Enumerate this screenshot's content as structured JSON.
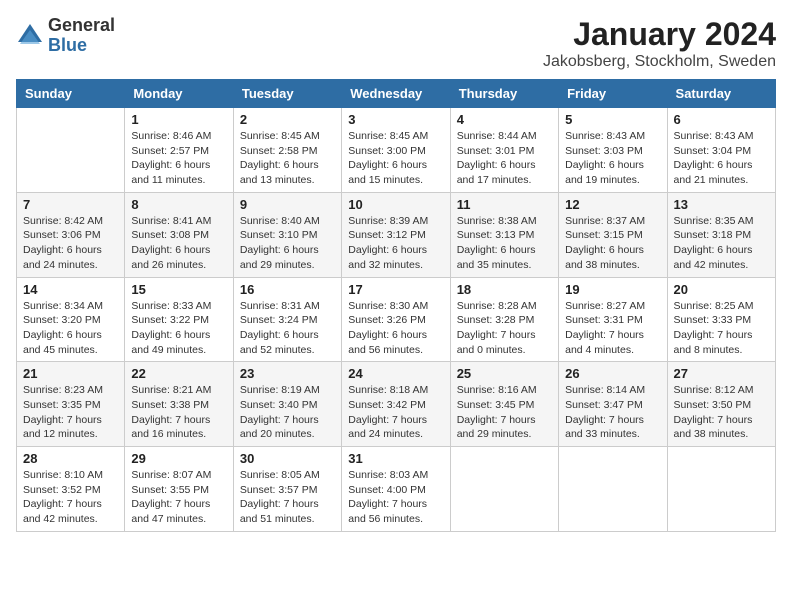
{
  "logo": {
    "line1": "General",
    "line2": "Blue"
  },
  "title": "January 2024",
  "subtitle": "Jakobsberg, Stockholm, Sweden",
  "days_of_week": [
    "Sunday",
    "Monday",
    "Tuesday",
    "Wednesday",
    "Thursday",
    "Friday",
    "Saturday"
  ],
  "weeks": [
    [
      {
        "num": "",
        "sunrise": "",
        "sunset": "",
        "daylight": ""
      },
      {
        "num": "1",
        "sunrise": "Sunrise: 8:46 AM",
        "sunset": "Sunset: 2:57 PM",
        "daylight": "Daylight: 6 hours and 11 minutes."
      },
      {
        "num": "2",
        "sunrise": "Sunrise: 8:45 AM",
        "sunset": "Sunset: 2:58 PM",
        "daylight": "Daylight: 6 hours and 13 minutes."
      },
      {
        "num": "3",
        "sunrise": "Sunrise: 8:45 AM",
        "sunset": "Sunset: 3:00 PM",
        "daylight": "Daylight: 6 hours and 15 minutes."
      },
      {
        "num": "4",
        "sunrise": "Sunrise: 8:44 AM",
        "sunset": "Sunset: 3:01 PM",
        "daylight": "Daylight: 6 hours and 17 minutes."
      },
      {
        "num": "5",
        "sunrise": "Sunrise: 8:43 AM",
        "sunset": "Sunset: 3:03 PM",
        "daylight": "Daylight: 6 hours and 19 minutes."
      },
      {
        "num": "6",
        "sunrise": "Sunrise: 8:43 AM",
        "sunset": "Sunset: 3:04 PM",
        "daylight": "Daylight: 6 hours and 21 minutes."
      }
    ],
    [
      {
        "num": "7",
        "sunrise": "Sunrise: 8:42 AM",
        "sunset": "Sunset: 3:06 PM",
        "daylight": "Daylight: 6 hours and 24 minutes."
      },
      {
        "num": "8",
        "sunrise": "Sunrise: 8:41 AM",
        "sunset": "Sunset: 3:08 PM",
        "daylight": "Daylight: 6 hours and 26 minutes."
      },
      {
        "num": "9",
        "sunrise": "Sunrise: 8:40 AM",
        "sunset": "Sunset: 3:10 PM",
        "daylight": "Daylight: 6 hours and 29 minutes."
      },
      {
        "num": "10",
        "sunrise": "Sunrise: 8:39 AM",
        "sunset": "Sunset: 3:12 PM",
        "daylight": "Daylight: 6 hours and 32 minutes."
      },
      {
        "num": "11",
        "sunrise": "Sunrise: 8:38 AM",
        "sunset": "Sunset: 3:13 PM",
        "daylight": "Daylight: 6 hours and 35 minutes."
      },
      {
        "num": "12",
        "sunrise": "Sunrise: 8:37 AM",
        "sunset": "Sunset: 3:15 PM",
        "daylight": "Daylight: 6 hours and 38 minutes."
      },
      {
        "num": "13",
        "sunrise": "Sunrise: 8:35 AM",
        "sunset": "Sunset: 3:18 PM",
        "daylight": "Daylight: 6 hours and 42 minutes."
      }
    ],
    [
      {
        "num": "14",
        "sunrise": "Sunrise: 8:34 AM",
        "sunset": "Sunset: 3:20 PM",
        "daylight": "Daylight: 6 hours and 45 minutes."
      },
      {
        "num": "15",
        "sunrise": "Sunrise: 8:33 AM",
        "sunset": "Sunset: 3:22 PM",
        "daylight": "Daylight: 6 hours and 49 minutes."
      },
      {
        "num": "16",
        "sunrise": "Sunrise: 8:31 AM",
        "sunset": "Sunset: 3:24 PM",
        "daylight": "Daylight: 6 hours and 52 minutes."
      },
      {
        "num": "17",
        "sunrise": "Sunrise: 8:30 AM",
        "sunset": "Sunset: 3:26 PM",
        "daylight": "Daylight: 6 hours and 56 minutes."
      },
      {
        "num": "18",
        "sunrise": "Sunrise: 8:28 AM",
        "sunset": "Sunset: 3:28 PM",
        "daylight": "Daylight: 7 hours and 0 minutes."
      },
      {
        "num": "19",
        "sunrise": "Sunrise: 8:27 AM",
        "sunset": "Sunset: 3:31 PM",
        "daylight": "Daylight: 7 hours and 4 minutes."
      },
      {
        "num": "20",
        "sunrise": "Sunrise: 8:25 AM",
        "sunset": "Sunset: 3:33 PM",
        "daylight": "Daylight: 7 hours and 8 minutes."
      }
    ],
    [
      {
        "num": "21",
        "sunrise": "Sunrise: 8:23 AM",
        "sunset": "Sunset: 3:35 PM",
        "daylight": "Daylight: 7 hours and 12 minutes."
      },
      {
        "num": "22",
        "sunrise": "Sunrise: 8:21 AM",
        "sunset": "Sunset: 3:38 PM",
        "daylight": "Daylight: 7 hours and 16 minutes."
      },
      {
        "num": "23",
        "sunrise": "Sunrise: 8:19 AM",
        "sunset": "Sunset: 3:40 PM",
        "daylight": "Daylight: 7 hours and 20 minutes."
      },
      {
        "num": "24",
        "sunrise": "Sunrise: 8:18 AM",
        "sunset": "Sunset: 3:42 PM",
        "daylight": "Daylight: 7 hours and 24 minutes."
      },
      {
        "num": "25",
        "sunrise": "Sunrise: 8:16 AM",
        "sunset": "Sunset: 3:45 PM",
        "daylight": "Daylight: 7 hours and 29 minutes."
      },
      {
        "num": "26",
        "sunrise": "Sunrise: 8:14 AM",
        "sunset": "Sunset: 3:47 PM",
        "daylight": "Daylight: 7 hours and 33 minutes."
      },
      {
        "num": "27",
        "sunrise": "Sunrise: 8:12 AM",
        "sunset": "Sunset: 3:50 PM",
        "daylight": "Daylight: 7 hours and 38 minutes."
      }
    ],
    [
      {
        "num": "28",
        "sunrise": "Sunrise: 8:10 AM",
        "sunset": "Sunset: 3:52 PM",
        "daylight": "Daylight: 7 hours and 42 minutes."
      },
      {
        "num": "29",
        "sunrise": "Sunrise: 8:07 AM",
        "sunset": "Sunset: 3:55 PM",
        "daylight": "Daylight: 7 hours and 47 minutes."
      },
      {
        "num": "30",
        "sunrise": "Sunrise: 8:05 AM",
        "sunset": "Sunset: 3:57 PM",
        "daylight": "Daylight: 7 hours and 51 minutes."
      },
      {
        "num": "31",
        "sunrise": "Sunrise: 8:03 AM",
        "sunset": "Sunset: 4:00 PM",
        "daylight": "Daylight: 7 hours and 56 minutes."
      },
      {
        "num": "",
        "sunrise": "",
        "sunset": "",
        "daylight": ""
      },
      {
        "num": "",
        "sunrise": "",
        "sunset": "",
        "daylight": ""
      },
      {
        "num": "",
        "sunrise": "",
        "sunset": "",
        "daylight": ""
      }
    ]
  ]
}
